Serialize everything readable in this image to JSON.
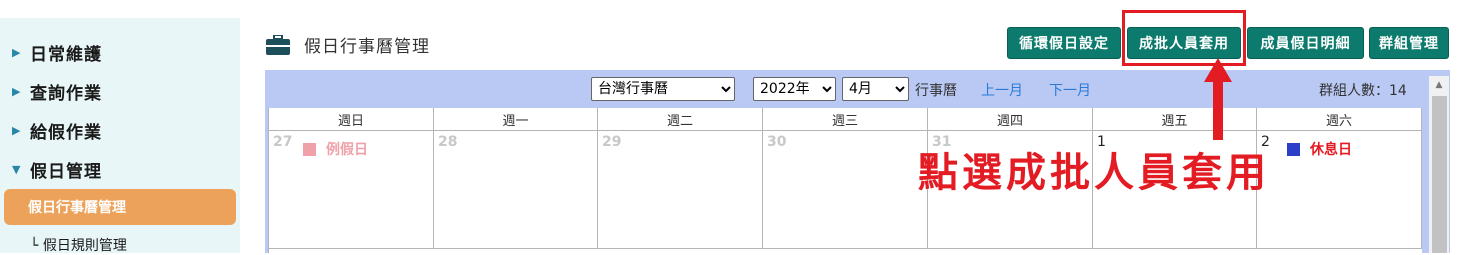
{
  "sidebar": {
    "items": [
      {
        "label": "日常維護",
        "expanded": false
      },
      {
        "label": "查詢作業",
        "expanded": false
      },
      {
        "label": "給假作業",
        "expanded": false
      },
      {
        "label": "假日管理",
        "expanded": true
      }
    ],
    "sub_items": [
      {
        "label": "假日行事曆管理",
        "active": true
      },
      {
        "label": "└ 假日規則管理",
        "active": false
      }
    ]
  },
  "header": {
    "title": "假日行事曆管理",
    "buttons": [
      "循環假日設定",
      "成批人員套用",
      "成員假日明細",
      "群組管理"
    ]
  },
  "toolbar": {
    "calendar_select": "台灣行事曆",
    "year_select": "2022年",
    "month_select": "4月",
    "calendar_label": "行事曆",
    "prev_month": "上一月",
    "next_month": "下一月",
    "group_count_label": "群組人數：14"
  },
  "calendar": {
    "weekdays": [
      "週日",
      "週一",
      "週二",
      "週三",
      "週四",
      "週五",
      "週六"
    ],
    "days": [
      {
        "num": "27",
        "other_month": true,
        "holiday": "例假日",
        "holiday_color": "#f0a0a8"
      },
      {
        "num": "28",
        "other_month": true,
        "holiday": "",
        "holiday_color": ""
      },
      {
        "num": "29",
        "other_month": true,
        "holiday": "",
        "holiday_color": ""
      },
      {
        "num": "30",
        "other_month": true,
        "holiday": "",
        "holiday_color": ""
      },
      {
        "num": "31",
        "other_month": true,
        "holiday": "",
        "holiday_color": ""
      },
      {
        "num": "1",
        "other_month": false,
        "holiday": "",
        "holiday_color": ""
      },
      {
        "num": "2",
        "other_month": false,
        "holiday": "休息日",
        "holiday_color": "#2c3fc8"
      }
    ]
  },
  "annotation": {
    "text": "點選成批人員套用",
    "color": "#e31b23"
  },
  "colors": {
    "button_bg": "#0c7a6c",
    "active_nav_bg": "#eca25a",
    "sidebar_bg": "#e8f6f8",
    "toolbar_bg": "#bac9f4",
    "holiday_text_red": "#e31b23"
  }
}
